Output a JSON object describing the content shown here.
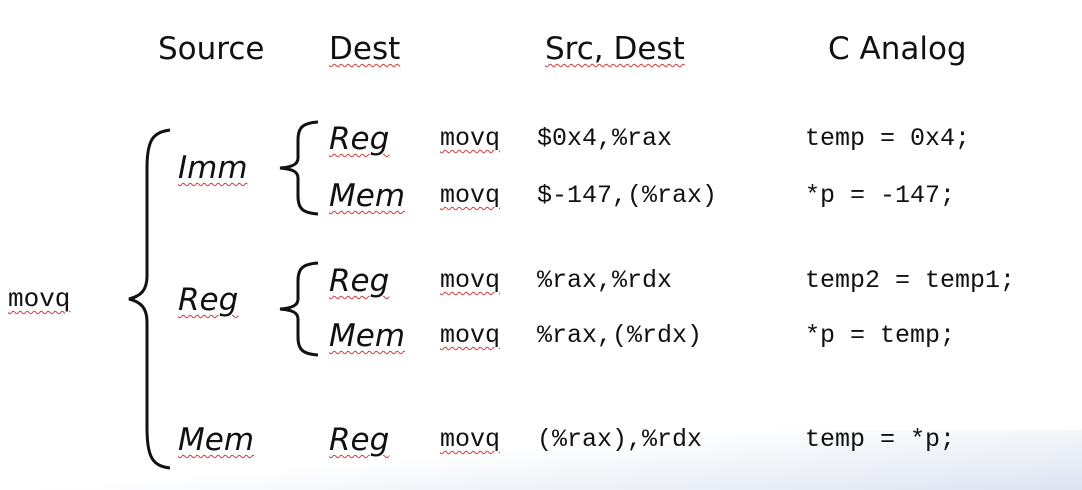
{
  "headers": {
    "source": "Source",
    "dest": "Dest",
    "src_dest": "Src, Dest",
    "c_analog": "C Analog"
  },
  "instruction": "movq",
  "sources": {
    "imm": "Imm",
    "reg": "Reg",
    "mem": "Mem"
  },
  "rows": [
    {
      "dest": "Reg",
      "asm_op": "movq",
      "asm_args": "$0x4,%rax",
      "c": "temp = 0x4;"
    },
    {
      "dest": "Mem",
      "asm_op": "movq",
      "asm_args": "$-147,(%rax)",
      "c": "*p = -147;"
    },
    {
      "dest": "Reg",
      "asm_op": "movq",
      "asm_args": "%rax,%rdx",
      "c": "temp2 = temp1;"
    },
    {
      "dest": "Mem",
      "asm_op": "movq",
      "asm_args": "%rax,(%rdx)",
      "c": "*p = temp;"
    },
    {
      "dest": "Reg",
      "asm_op": "movq",
      "asm_args": "(%rax),%rdx",
      "c": "temp = *p;"
    }
  ]
}
